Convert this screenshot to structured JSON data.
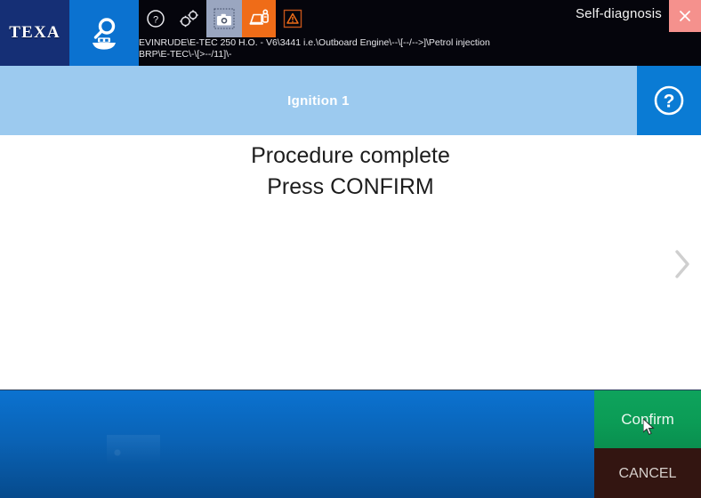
{
  "window": {
    "app_title": "Self-diagnosis",
    "close_label": "✕",
    "close_color": "#f5918d"
  },
  "branding": {
    "logo_text": "TEXA",
    "logo_bg": "#152f75",
    "mode_icon": "boat-diagnosis-icon",
    "mode_bg": "#0b72d0"
  },
  "toolbar": {
    "items": [
      {
        "name": "help-icon",
        "label": "?",
        "active": false
      },
      {
        "name": "settings-gears-icon",
        "label": "",
        "active": false
      },
      {
        "name": "screenshot-camera-icon",
        "label": "",
        "active": true,
        "bg": "#9aa6c0"
      },
      {
        "name": "device-connection-icon",
        "label": "",
        "active": true,
        "bg": "#ef6c18"
      },
      {
        "name": "warning-triangle-icon",
        "label": "",
        "active": false
      }
    ]
  },
  "vehicle": {
    "info": "EVINRUDE\\E-TEC 250 H.O. - V6\\3441 i.e.\\Outboard Engine\\--\\[--/-->]\\Petrol injection\nBRP\\E-TEC\\-\\[>--/11]\\-"
  },
  "header": {
    "title": "Ignition 1",
    "band_color": "#9ccaef",
    "help_button_color": "#0a7bd4",
    "help_icon": "question-circle-icon"
  },
  "main": {
    "message": "Procedure complete\nPress CONFIRM",
    "next_arrow_icon": "chevron-right-icon"
  },
  "footer": {
    "confirm_label": "Confirm",
    "confirm_color": "#0b9c56",
    "cancel_label": "CANCEL",
    "cancel_color": "#331511",
    "bar_color": "#0a63b6"
  }
}
